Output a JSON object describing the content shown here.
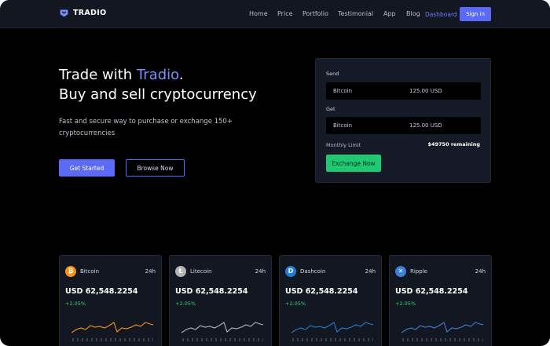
{
  "brand": {
    "name": "TRADIO",
    "accent": "#5b6bf7"
  },
  "nav": {
    "links": [
      "Home",
      "Price",
      "Portfolio",
      "Testimonial",
      "App",
      "Blog"
    ],
    "active_link": "Dashboard",
    "signin_label": "Sign in"
  },
  "hero": {
    "title_prefix": "Trade with ",
    "title_brand": "Tradio",
    "title_suffix": ".",
    "title_line2": "Buy and sell cryptocurrency",
    "subtitle": "Fast and secure way to purchase or exchange 150+ cryptocurrencies",
    "primary_cta": "Get Started",
    "secondary_cta": "Browse Now"
  },
  "exchange": {
    "send_label": "Send",
    "send_coin": "Bitcoin",
    "send_amount": "125.00 USD",
    "get_label": "Get",
    "get_coin": "Bitcoin",
    "get_amount": "125.00 USD",
    "limit_label": "Monthly Limit",
    "limit_value": "$49750 remaining",
    "button_label": "Exchange Now"
  },
  "tickers": [
    {
      "name": "Bitcoin",
      "period": "24h",
      "price": "USD 62,548.2254",
      "change": "+2.05%",
      "color": "#f7931a",
      "icon": "bitcoin-icon",
      "glyph": "₿"
    },
    {
      "name": "Litecoin",
      "period": "24h",
      "price": "USD 62,548.2254",
      "change": "+2.05%",
      "color": "#b5b5b5",
      "icon": "litecoin-icon",
      "glyph": "Ł"
    },
    {
      "name": "Dashcoin",
      "period": "24h",
      "price": "USD 62,548.2254",
      "change": "+2.05%",
      "color": "#1f7fd6",
      "icon": "dashcoin-icon",
      "glyph": "D"
    },
    {
      "name": "Ripple",
      "period": "24h",
      "price": "USD 62,548.2254",
      "change": "+2.05%",
      "color": "#3f7fd6",
      "icon": "ripple-icon",
      "glyph": "✕"
    }
  ]
}
